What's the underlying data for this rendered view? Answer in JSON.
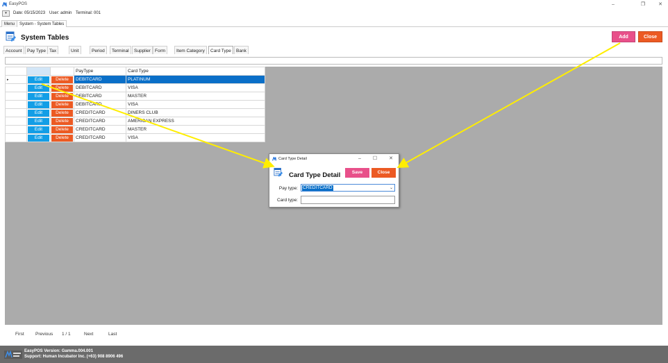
{
  "window": {
    "title": "EasyPOS",
    "minimize_glyph": "–",
    "restore_glyph": "❐",
    "close_glyph": "✕"
  },
  "infobar": {
    "dropdown_glyph": "▾",
    "date": "Date: 05/15/2023",
    "user": "User: admin",
    "terminal": "Terminal: 001"
  },
  "main_tabs": [
    "Menu",
    "System - System Tables"
  ],
  "header": {
    "title": "System Tables",
    "add_label": "Add",
    "close_label": "Close"
  },
  "sub_tabs": [
    "Account",
    "Pay Type",
    "Tax",
    "Unit",
    "Period",
    "Terminal",
    "Supplier",
    "Form",
    "Item Category",
    "Card Type",
    "Bank"
  ],
  "active_sub_tab": "Card Type",
  "grid": {
    "columns": [
      "",
      "",
      "PayType",
      "Card Type"
    ],
    "edit_label": "Edit",
    "delete_label": "Delete",
    "row_marker": "▸",
    "rows": [
      {
        "paytype": "DEBITCARD",
        "cardtype": "PLATINUM"
      },
      {
        "paytype": "DEBITCARD",
        "cardtype": "VISA"
      },
      {
        "paytype": "DEBITCARD",
        "cardtype": "MASTER"
      },
      {
        "paytype": "DEBITCARD",
        "cardtype": "VISA"
      },
      {
        "paytype": "CREDITCARD",
        "cardtype": "DINERS CLUB"
      },
      {
        "paytype": "CREDITCARD",
        "cardtype": "AMERICAN EXPRESS"
      },
      {
        "paytype": "CREDITCARD",
        "cardtype": "MASTER"
      },
      {
        "paytype": "CREDITCARD",
        "cardtype": "VISA"
      }
    ]
  },
  "pager": {
    "first": "First",
    "previous": "Previous",
    "page": "1 / 1",
    "next": "Next",
    "last": "Last"
  },
  "footer": {
    "version": "EasyPOS Version: Gamma.004.001",
    "support": "Support: Human Incubator Inc. (+63) 908 8906 496"
  },
  "dialog": {
    "window_title": "Card Type Detail",
    "heading": "Card Type Detail",
    "save_label": "Save",
    "close_label": "Close",
    "pay_type_label": "Pay type:",
    "pay_type_value": "CREDITCARD",
    "card_type_label": "Card type:",
    "card_type_value": "",
    "select_caret": "⌄",
    "min_glyph": "–",
    "max_glyph": "☐",
    "close_glyph": "✕"
  },
  "colors": {
    "edit": "#139ee6",
    "delete": "#ec5a23",
    "add": "#e8508a",
    "close": "#ec5a23",
    "selection": "#0a6fc8",
    "annotation_arrow": "#ffee00",
    "grid_background": "#ababab",
    "footer": "#6b6b6b"
  }
}
